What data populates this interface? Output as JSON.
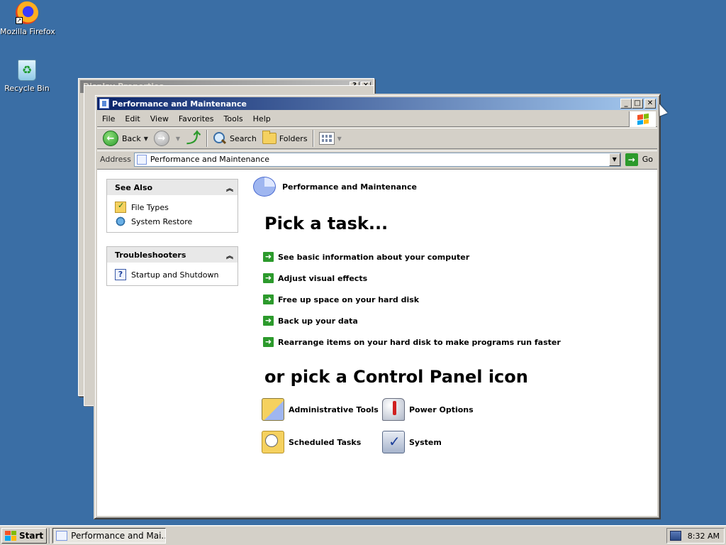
{
  "desktop": {
    "icons": [
      {
        "label": "Mozilla Firefox",
        "icon": "firefox-icon"
      },
      {
        "label": "Recycle Bin",
        "icon": "recycle-bin-icon"
      }
    ]
  },
  "background_window": {
    "title": "Display Properties",
    "buttons": [
      "?",
      "✕"
    ]
  },
  "window": {
    "title": "Performance and Maintenance",
    "controls": {
      "minimize": "_",
      "maximize": "□",
      "close": "✕"
    },
    "menu": [
      "File",
      "Edit",
      "View",
      "Favorites",
      "Tools",
      "Help"
    ],
    "toolbar": {
      "back": "Back",
      "search": "Search",
      "folders": "Folders"
    },
    "address": {
      "label": "Address",
      "value": "Performance and Maintenance",
      "go": "Go"
    },
    "see_also": {
      "title": "See Also",
      "items": [
        {
          "label": "File Types",
          "icon": "file-types-icon"
        },
        {
          "label": "System Restore",
          "icon": "system-restore-icon"
        }
      ]
    },
    "troubleshooters": {
      "title": "Troubleshooters",
      "items": [
        {
          "label": "Startup and Shutdown",
          "icon": "help-icon"
        }
      ]
    },
    "category_title": "Performance and Maintenance",
    "pick_task_heading": "Pick a task...",
    "tasks": [
      "See basic information about your computer",
      "Adjust visual effects",
      "Free up space on your hard disk",
      "Back up your data",
      "Rearrange items on your hard disk to make programs run faster"
    ],
    "pick_icon_heading": "or pick a Control Panel icon",
    "control_panel_icons": [
      {
        "label": "Administrative Tools",
        "icon": "administrative-tools-icon"
      },
      {
        "label": "Power Options",
        "icon": "power-options-icon"
      },
      {
        "label": "Scheduled Tasks",
        "icon": "scheduled-tasks-icon"
      },
      {
        "label": "System",
        "icon": "system-icon"
      }
    ]
  },
  "taskbar": {
    "start": "Start",
    "active_task": "Performance and Mai...",
    "clock": "8:32 AM"
  }
}
